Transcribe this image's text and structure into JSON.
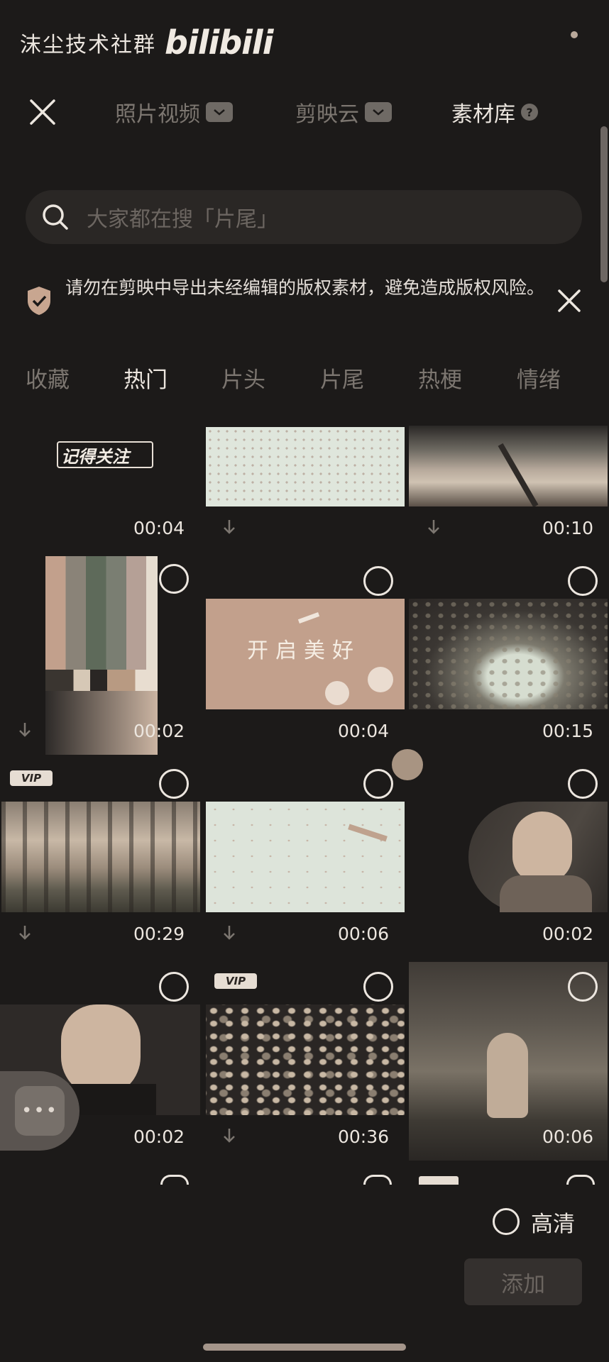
{
  "watermark": {
    "text": "沫尘技术社群",
    "logo": "bilibili"
  },
  "top_tabs": [
    {
      "label": "照片视频",
      "icon": "chevron-down-icon"
    },
    {
      "label": "剪映云",
      "icon": "chevron-down-icon"
    },
    {
      "label": "素材库",
      "icon": "help-icon",
      "active": true
    }
  ],
  "search": {
    "placeholder": "大家都在搜「片尾」"
  },
  "notice": {
    "text": "请勿在剪映中导出未经编辑的版权素材，避免造成版权风险。"
  },
  "categories": [
    {
      "label": "收藏"
    },
    {
      "label": "热门",
      "active": true
    },
    {
      "label": "片头"
    },
    {
      "label": "片尾"
    },
    {
      "label": "热梗"
    },
    {
      "label": "情绪"
    }
  ],
  "grid": {
    "items": [
      {
        "duration": "00:04",
        "overlay_text": "记得关注"
      },
      {
        "duration": ""
      },
      {
        "duration": "00:10"
      },
      {
        "duration": "00:02"
      },
      {
        "duration": "00:04",
        "overlay_text": "开启美好"
      },
      {
        "duration": "00:15"
      },
      {
        "duration": "00:29",
        "vip": "VIP"
      },
      {
        "duration": "00:06"
      },
      {
        "duration": "00:02"
      },
      {
        "duration": "00:02"
      },
      {
        "duration": "00:36",
        "vip": "VIP"
      },
      {
        "duration": "00:06"
      }
    ]
  },
  "bottom": {
    "hd_label": "高清",
    "add_label": "添加"
  },
  "colors": {
    "background": "#1c1a19",
    "text": "#ece6df",
    "muted": "#7c7670",
    "accent_tan": "#a89482"
  }
}
